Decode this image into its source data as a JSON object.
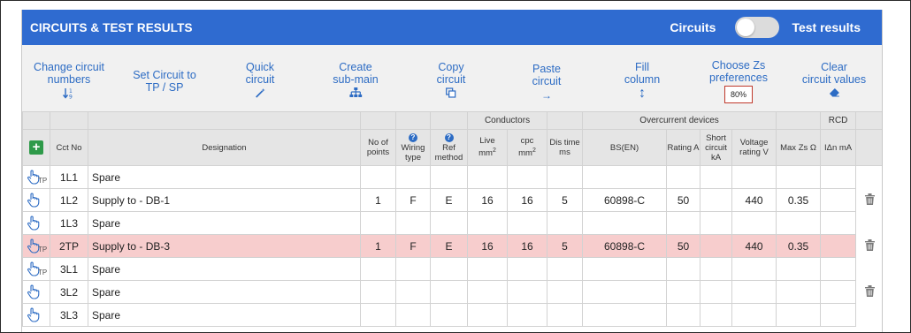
{
  "header": {
    "title": "CIRCUITS & TEST RESULTS",
    "toggle_left": "Circuits",
    "toggle_right": "Test results"
  },
  "toolbar": [
    {
      "name": "change-circuit-numbers-button",
      "line1": "Change circuit",
      "line2": "numbers",
      "icon": "↓⁰₉",
      "icon_name": "sort-numeric-icon"
    },
    {
      "name": "set-circuit-tp-sp-button",
      "line1": "Set Circuit to",
      "line2": "TP / SP",
      "icon": "",
      "icon_name": ""
    },
    {
      "name": "quick-circuit-button",
      "line1": "Quick",
      "line2": "circuit",
      "icon": "✎",
      "icon_name": "magic-wand-icon"
    },
    {
      "name": "create-sub-main-button",
      "line1": "Create",
      "line2": "sub-main",
      "icon": "⁂",
      "icon_name": "sitemap-icon"
    },
    {
      "name": "copy-circuit-button",
      "line1": "Copy",
      "line2": "circuit",
      "icon": "⧉",
      "icon_name": "copy-icon"
    },
    {
      "name": "paste-circuit-button",
      "line1": "Paste",
      "line2": "circuit",
      "icon": "→",
      "icon_name": "arrow-right-icon"
    },
    {
      "name": "fill-column-button",
      "line1": "Fill",
      "line2": "column",
      "icon": "↕",
      "icon_name": "arrow-up-down-icon"
    },
    {
      "name": "choose-zs-preferences-button",
      "line1": "Choose Zs",
      "line2": "preferences",
      "badge": "80%"
    },
    {
      "name": "clear-circuit-values-button",
      "line1": "Clear",
      "line2": "circuit values",
      "icon": "▰",
      "icon_name": "eraser-icon"
    }
  ],
  "groups": {
    "conductors": "Conductors",
    "overcurrent": "Overcurrent devices",
    "rcd": "RCD"
  },
  "columns": {
    "cct_no": "Cct No",
    "designation": "Designation",
    "no_points": "No of points",
    "wiring_type": "Wiring type",
    "ref_method": "Ref method",
    "live": "Live",
    "cpc": "cpc",
    "mm": "mm",
    "sq": "2",
    "dis_time": "Dis time ms",
    "bs_en": "BS(EN)",
    "rating": "Rating A",
    "short_circuit": "Short circuit kA",
    "voltage_rating": "Voltage rating V",
    "max_zs": "Max Zs Ω",
    "idn": "IΔn mA"
  },
  "rows": [
    {
      "tp": true,
      "cct": "1L1",
      "designation": "Spare",
      "points": "",
      "wiring": "",
      "ref": "",
      "live": "",
      "cpc": "",
      "dis": "",
      "bs": "",
      "rating": "",
      "short": "",
      "voltage": "",
      "maxzs": "",
      "idn": "",
      "trash": false,
      "hl": false
    },
    {
      "tp": false,
      "cct": "1L2",
      "designation": "Supply to - DB-1",
      "points": "1",
      "wiring": "F",
      "ref": "E",
      "live": "16",
      "cpc": "16",
      "dis": "5",
      "bs": "60898-C",
      "rating": "50",
      "short": "",
      "voltage": "440",
      "maxzs": "0.35",
      "idn": "",
      "trash": true,
      "hl": false
    },
    {
      "tp": false,
      "cct": "1L3",
      "designation": "Spare",
      "points": "",
      "wiring": "",
      "ref": "",
      "live": "",
      "cpc": "",
      "dis": "",
      "bs": "",
      "rating": "",
      "short": "",
      "voltage": "",
      "maxzs": "",
      "idn": "",
      "trash": false,
      "hl": false
    },
    {
      "tp": true,
      "cct": "2TP",
      "designation": "Supply to - DB-3",
      "points": "1",
      "wiring": "F",
      "ref": "E",
      "live": "16",
      "cpc": "16",
      "dis": "5",
      "bs": "60898-C",
      "rating": "50",
      "short": "",
      "voltage": "440",
      "maxzs": "0.35",
      "idn": "",
      "trash": true,
      "hl": true
    },
    {
      "tp": true,
      "cct": "3L1",
      "designation": "Spare",
      "points": "",
      "wiring": "",
      "ref": "",
      "live": "",
      "cpc": "",
      "dis": "",
      "bs": "",
      "rating": "",
      "short": "",
      "voltage": "",
      "maxzs": "",
      "idn": "",
      "trash": false,
      "hl": false
    },
    {
      "tp": false,
      "cct": "3L2",
      "designation": "Spare",
      "points": "",
      "wiring": "",
      "ref": "",
      "live": "",
      "cpc": "",
      "dis": "",
      "bs": "",
      "rating": "",
      "short": "",
      "voltage": "",
      "maxzs": "",
      "idn": "",
      "trash": true,
      "hl": false
    },
    {
      "tp": false,
      "cct": "3L3",
      "designation": "Spare",
      "points": "",
      "wiring": "",
      "ref": "",
      "live": "",
      "cpc": "",
      "dis": "",
      "bs": "",
      "rating": "",
      "short": "",
      "voltage": "",
      "maxzs": "",
      "idn": "",
      "trash": false,
      "hl": false
    }
  ],
  "labels": {
    "tp": "TP",
    "add": "+",
    "help": "?",
    "trash": "🗑"
  },
  "colors": {
    "header": "#2f6bd0",
    "link": "#2d6cc4",
    "highlight_row": "#f7cdcd",
    "add_button": "#2e9a49"
  }
}
